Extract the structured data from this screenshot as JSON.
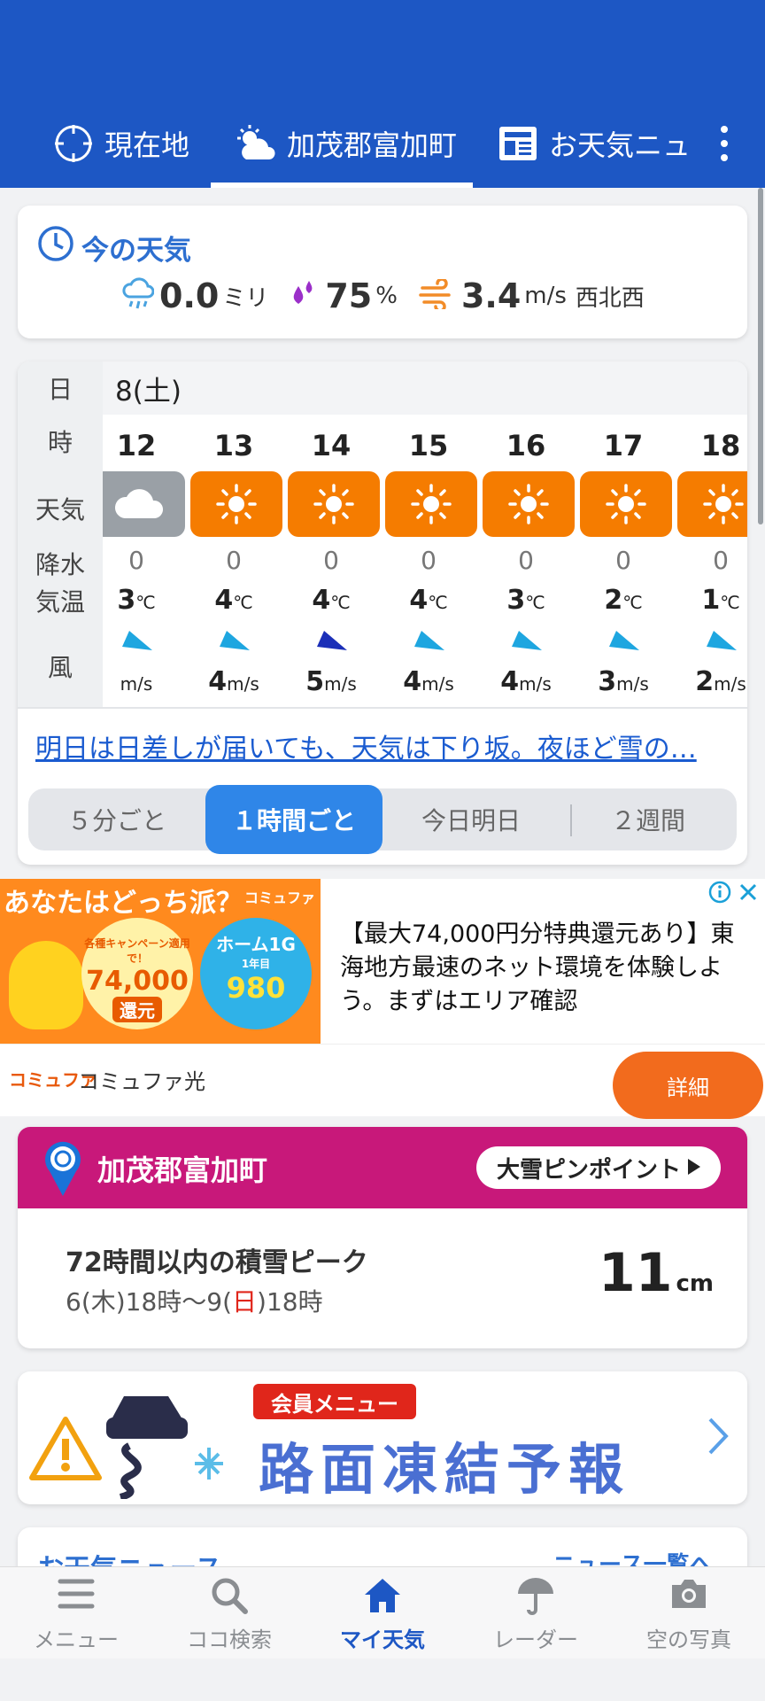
{
  "header": {
    "tabs": [
      {
        "label": "現在地",
        "icon": "crosshair-icon"
      },
      {
        "label": "加茂郡富加町",
        "icon": "sun-cloud-icon"
      },
      {
        "label": "お天気ニュ",
        "icon": "newspaper-icon"
      }
    ],
    "active_tab": 1
  },
  "current": {
    "title": "今の天気",
    "rain_value": "0.0",
    "rain_unit": "ミリ",
    "humidity_value": "75",
    "humidity_unit": "%",
    "wind_value": "3.4",
    "wind_unit": "m/s",
    "wind_dir": "西北西"
  },
  "forecast": {
    "date": "8(土)",
    "row_labels": {
      "day": "日",
      "hour": "時",
      "weather": "天気",
      "precip": "降水",
      "temp": "気温",
      "wind": "風"
    },
    "temp_unit": "℃",
    "wind_unit": "m/s",
    "hours": [
      {
        "hour": "12",
        "weather": "cloudy",
        "precip": "0",
        "temp": "3",
        "wind": "",
        "dir": "se",
        "strong": false
      },
      {
        "hour": "13",
        "weather": "sunny",
        "precip": "0",
        "temp": "4",
        "wind": "4",
        "dir": "se",
        "strong": false
      },
      {
        "hour": "14",
        "weather": "sunny",
        "precip": "0",
        "temp": "4",
        "wind": "5",
        "dir": "se",
        "strong": true
      },
      {
        "hour": "15",
        "weather": "sunny",
        "precip": "0",
        "temp": "4",
        "wind": "4",
        "dir": "se",
        "strong": false
      },
      {
        "hour": "16",
        "weather": "sunny",
        "precip": "0",
        "temp": "3",
        "wind": "4",
        "dir": "se",
        "strong": false
      },
      {
        "hour": "17",
        "weather": "sunny",
        "precip": "0",
        "temp": "2",
        "wind": "3",
        "dir": "se",
        "strong": false
      },
      {
        "hour": "18",
        "weather": "sunny",
        "precip": "0",
        "temp": "1",
        "wind": "2",
        "dir": "se",
        "strong": false
      }
    ],
    "news_link": "明日は日差しが届いても、天気は下り坂。夜ほど雪の…",
    "segments": [
      "５分ごと",
      "１時間ごと",
      "今日明日",
      "２週間"
    ],
    "active_segment": 1
  },
  "ad": {
    "headline": "あなたはどっち派？",
    "brand_small": "コミュファ",
    "circle1": {
      "top": "各種キャンペーン適用で！",
      "amount": "74,000",
      "bottom": "還元"
    },
    "circle2": {
      "top": "ホーム1G",
      "sub": "1年目",
      "amount": "980"
    },
    "text": "【最大74,000円分特典還元あり】東海地方最速のネット環境を体験しよう。まずはエリア確認",
    "foot_logo": "コミュファ",
    "foot_name": "コミュファ光",
    "cta": "詳細"
  },
  "snow": {
    "location": "加茂郡富加町",
    "button": "大雪ピンポイント",
    "title": "72時間以内の積雪ピーク",
    "period_a": "6(木)18時〜9(",
    "period_red": "日",
    "period_b": ")18時",
    "value": "11",
    "unit": "cm"
  },
  "road": {
    "badge": "会員メニュー",
    "title": "路面凍結予報"
  },
  "news": {
    "title": "お天気ニュース",
    "more": "ニュース一覧へ"
  },
  "bottom_nav": [
    {
      "label": "メニュー",
      "icon": "menu-icon"
    },
    {
      "label": "ココ検索",
      "icon": "search-icon"
    },
    {
      "label": "マイ天気",
      "icon": "home-icon"
    },
    {
      "label": "レーダー",
      "icon": "umbrella-radar-icon"
    },
    {
      "label": "空の写真",
      "icon": "camera-icon"
    }
  ],
  "colors": {
    "header": "#1d57c4",
    "sunny": "#f57c00",
    "accent": "#2f86e8",
    "snow_header": "#c8187a"
  }
}
